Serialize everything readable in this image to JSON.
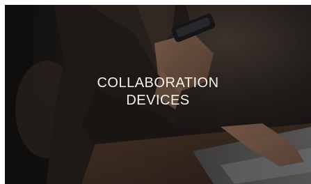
{
  "card": {
    "title_line1": "COLLABORATION",
    "title_line2": "DEVICES",
    "image_subject": "person-holding-phone-at-laptop-photo",
    "overlay_color": "#0a0a0a"
  }
}
